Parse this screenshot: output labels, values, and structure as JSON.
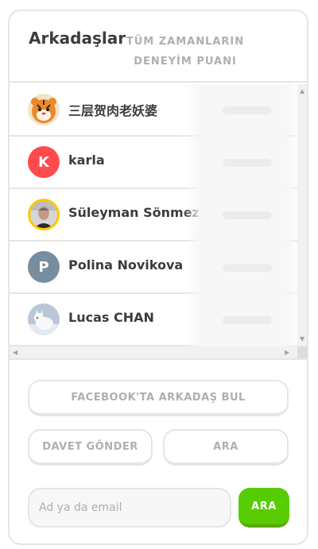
{
  "header": {
    "title": "Arkadaşlar",
    "subtitle": "TÜM ZAMANLARIN DENEYİM PUANI"
  },
  "friends": [
    {
      "name": "三层贺肉老妖婆",
      "avatar": {
        "type": "image",
        "icon": "tiger-avatar-icon"
      }
    },
    {
      "name": "karla",
      "avatar": {
        "type": "initial",
        "initial": "K",
        "color": "#ff4b4b"
      }
    },
    {
      "name": "Süleyman Sönmez",
      "avatar": {
        "type": "image",
        "icon": "person-photo-avatar-icon",
        "ring_color": "#ffc800"
      }
    },
    {
      "name": "Polina Novikova",
      "avatar": {
        "type": "initial",
        "initial": "P",
        "color": "#778da0"
      }
    },
    {
      "name": "Lucas CHAN",
      "avatar": {
        "type": "image",
        "icon": "arctic-fox-avatar-icon"
      }
    }
  ],
  "actions": {
    "facebook_label": "FACEBOOK'TA ARKADAŞ BUL",
    "invite_label": "DAVET GÖNDER",
    "search_label": "ARA",
    "search_placeholder": "Ad ya da email",
    "search_value": "",
    "go_label": "ARA"
  },
  "colors": {
    "text_primary": "#3c3c3c",
    "text_muted": "#afafaf",
    "border": "#e5e5e5",
    "accent_green": "#58cc02"
  }
}
